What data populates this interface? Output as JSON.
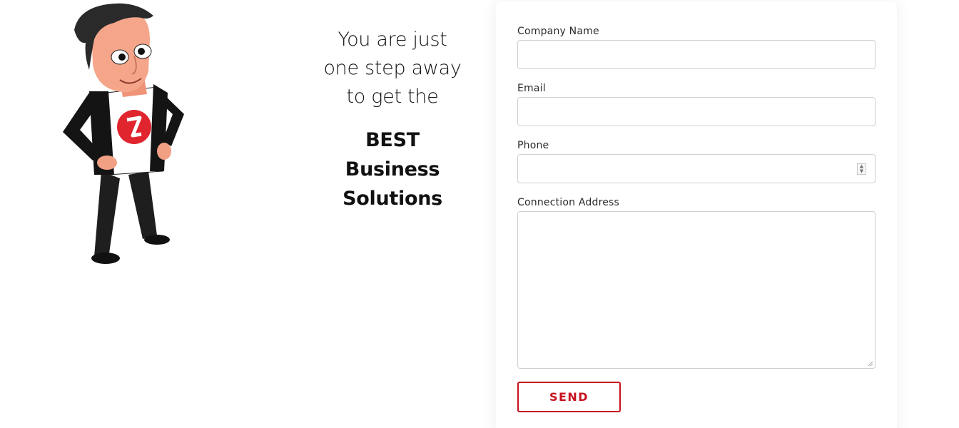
{
  "pitch": {
    "lead": [
      "You are just",
      "one step away",
      "to get the"
    ],
    "strong": [
      "BEST",
      "Business",
      "Solutions"
    ]
  },
  "form": {
    "company_label": "Company Name",
    "email_label": "Email",
    "phone_label": "Phone",
    "address_label": "Connection Address",
    "send_label": "SEND"
  },
  "icons": {
    "mascot": "cartoon-businessman",
    "shirt_logo": "red-circle-logo",
    "spinner": "number-stepper"
  },
  "colors": {
    "accent": "#c8101e",
    "border": "#cfcfcf",
    "text": "#111111"
  }
}
